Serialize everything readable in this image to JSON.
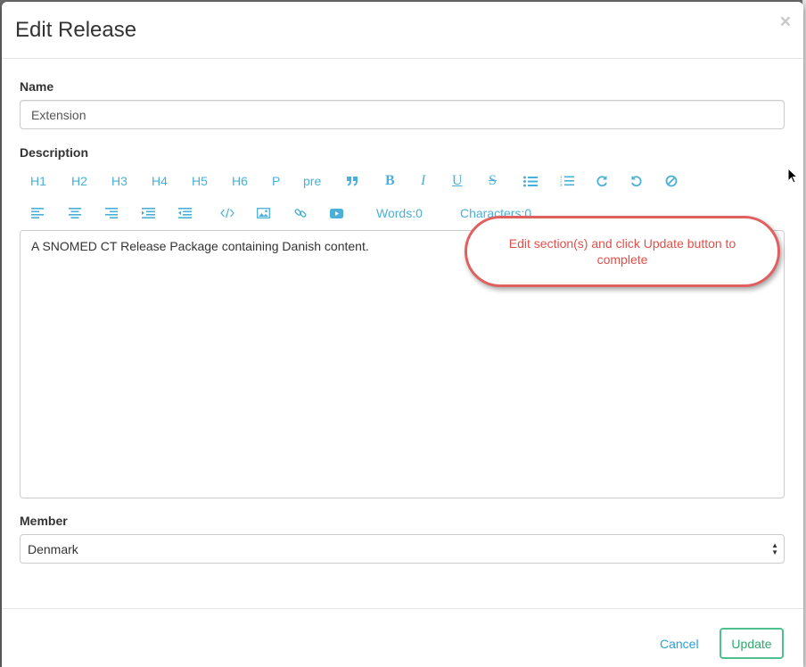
{
  "modal": {
    "title": "Edit Release",
    "close_label": "×"
  },
  "form": {
    "name_label": "Name",
    "name_value": "Extension",
    "description_label": "Description",
    "description_text": "A SNOMED CT Release Package  containing Danish content.",
    "member_label": "Member",
    "member_selected": "Denmark"
  },
  "toolbar": {
    "headings": [
      "H1",
      "H2",
      "H3",
      "H4",
      "H5",
      "H6",
      "P",
      "pre"
    ],
    "icons_row1": [
      "quote-icon",
      "bold-icon",
      "italic-icon",
      "underline-icon",
      "strikethrough-icon",
      "unordered-list-icon",
      "ordered-list-icon",
      "redo-icon",
      "undo-icon",
      "clear-format-icon"
    ],
    "icons_row2": [
      "align-left-icon",
      "align-center-icon",
      "align-right-icon",
      "indent-icon",
      "outdent-icon",
      "html-code-icon",
      "image-icon",
      "link-icon",
      "video-icon"
    ],
    "words_label": "Words:0",
    "characters_label": "Characters:0"
  },
  "callout": {
    "text": "Edit section(s) and click Update button to complete"
  },
  "footer": {
    "cancel_label": "Cancel",
    "update_label": "Update"
  },
  "colors": {
    "toolbar_accent": "#4ab0d9",
    "callout_border": "#e06060",
    "update_border": "#4fc08d",
    "cancel_link": "#2a9fd6"
  }
}
